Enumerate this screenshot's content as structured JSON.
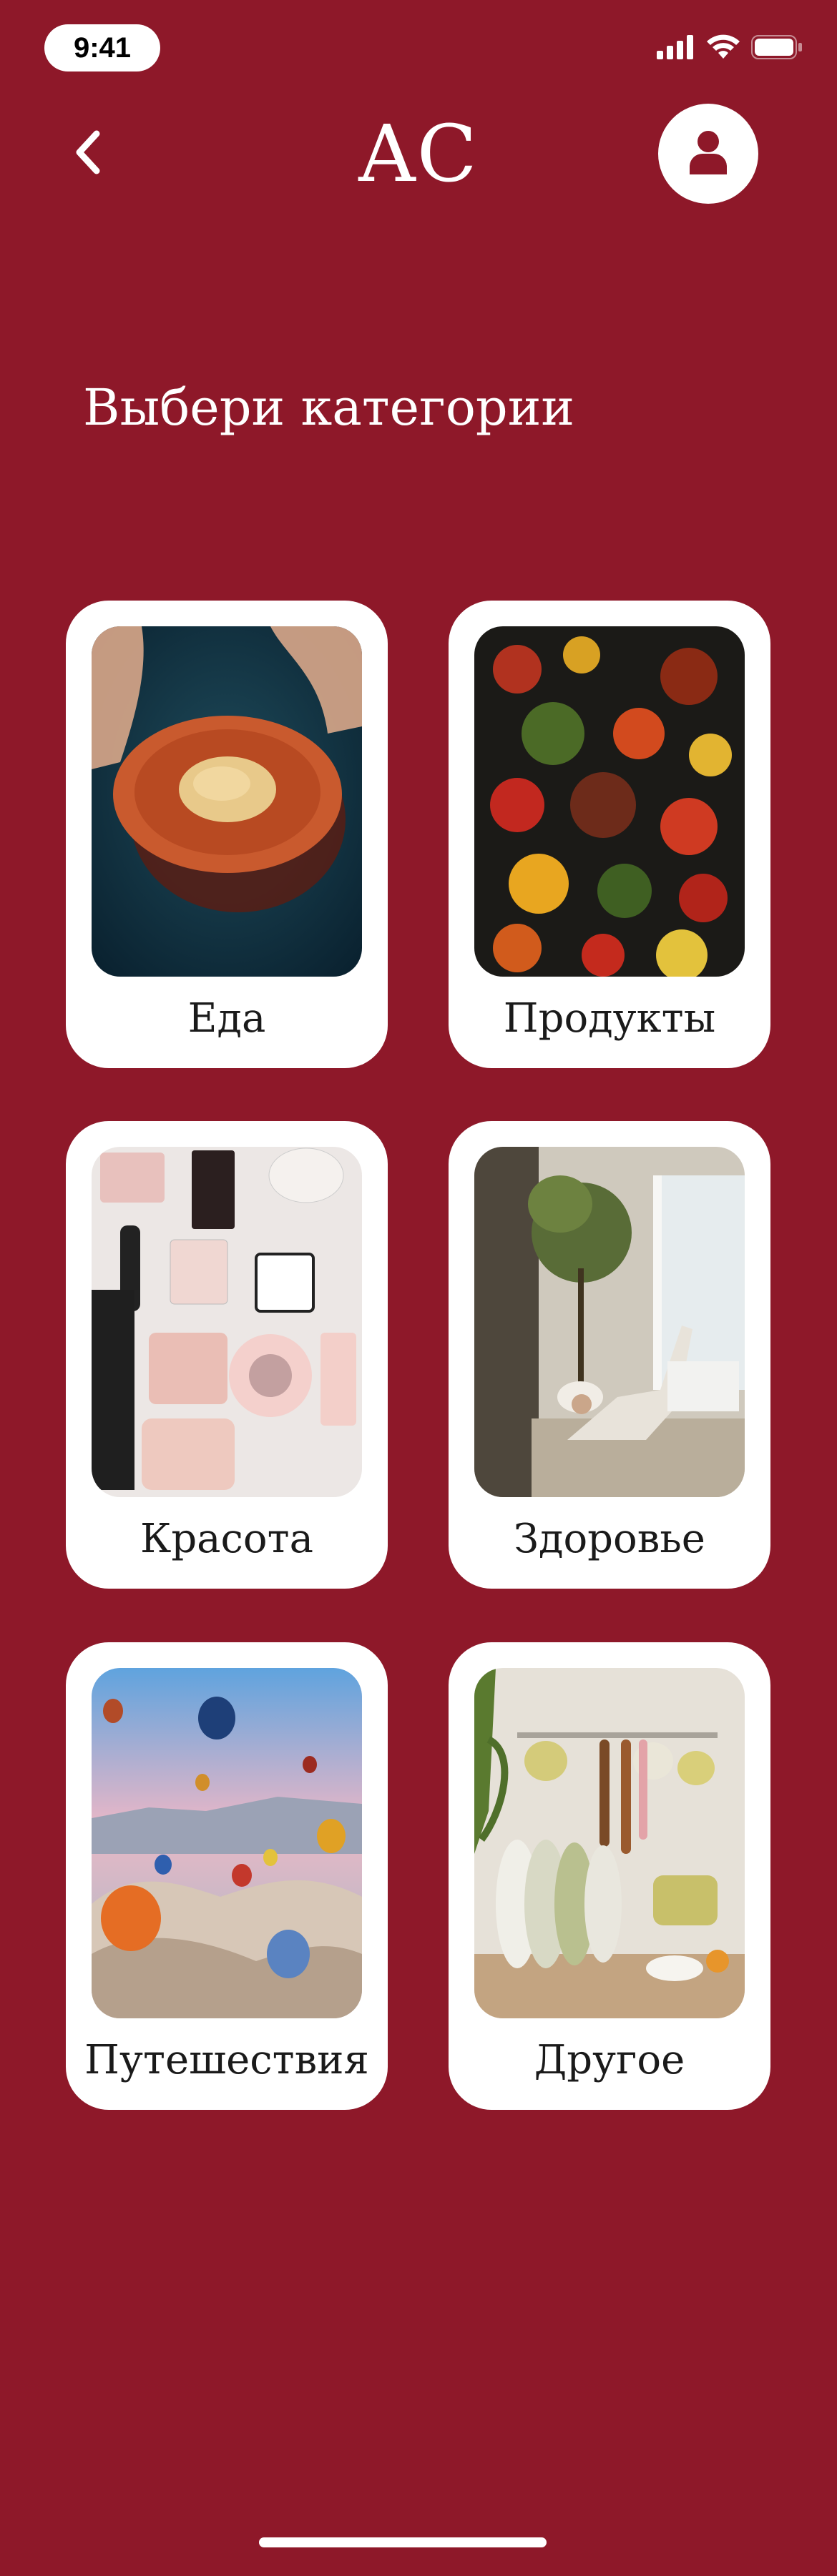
{
  "status_bar": {
    "time": "9:41"
  },
  "header": {
    "title": "AC",
    "back_icon": "chevron-left-icon",
    "profile_icon": "user-icon"
  },
  "heading": "Выбери категории",
  "categories": [
    {
      "label": "Еда",
      "image": "food-plate-photo"
    },
    {
      "label": "Продукты",
      "image": "vegetables-photo"
    },
    {
      "label": "Красота",
      "image": "cosmetics-photo"
    },
    {
      "label": "Здоровье",
      "image": "yoga-photo"
    },
    {
      "label": "Путешествия",
      "image": "hot-air-balloons-photo"
    },
    {
      "label": "Другое",
      "image": "kitchen-utensils-photo"
    }
  ],
  "colors": {
    "background": "#8e1829",
    "card": "#ffffff",
    "text_light": "#ffffff",
    "text_dark": "#1a1a1a"
  }
}
